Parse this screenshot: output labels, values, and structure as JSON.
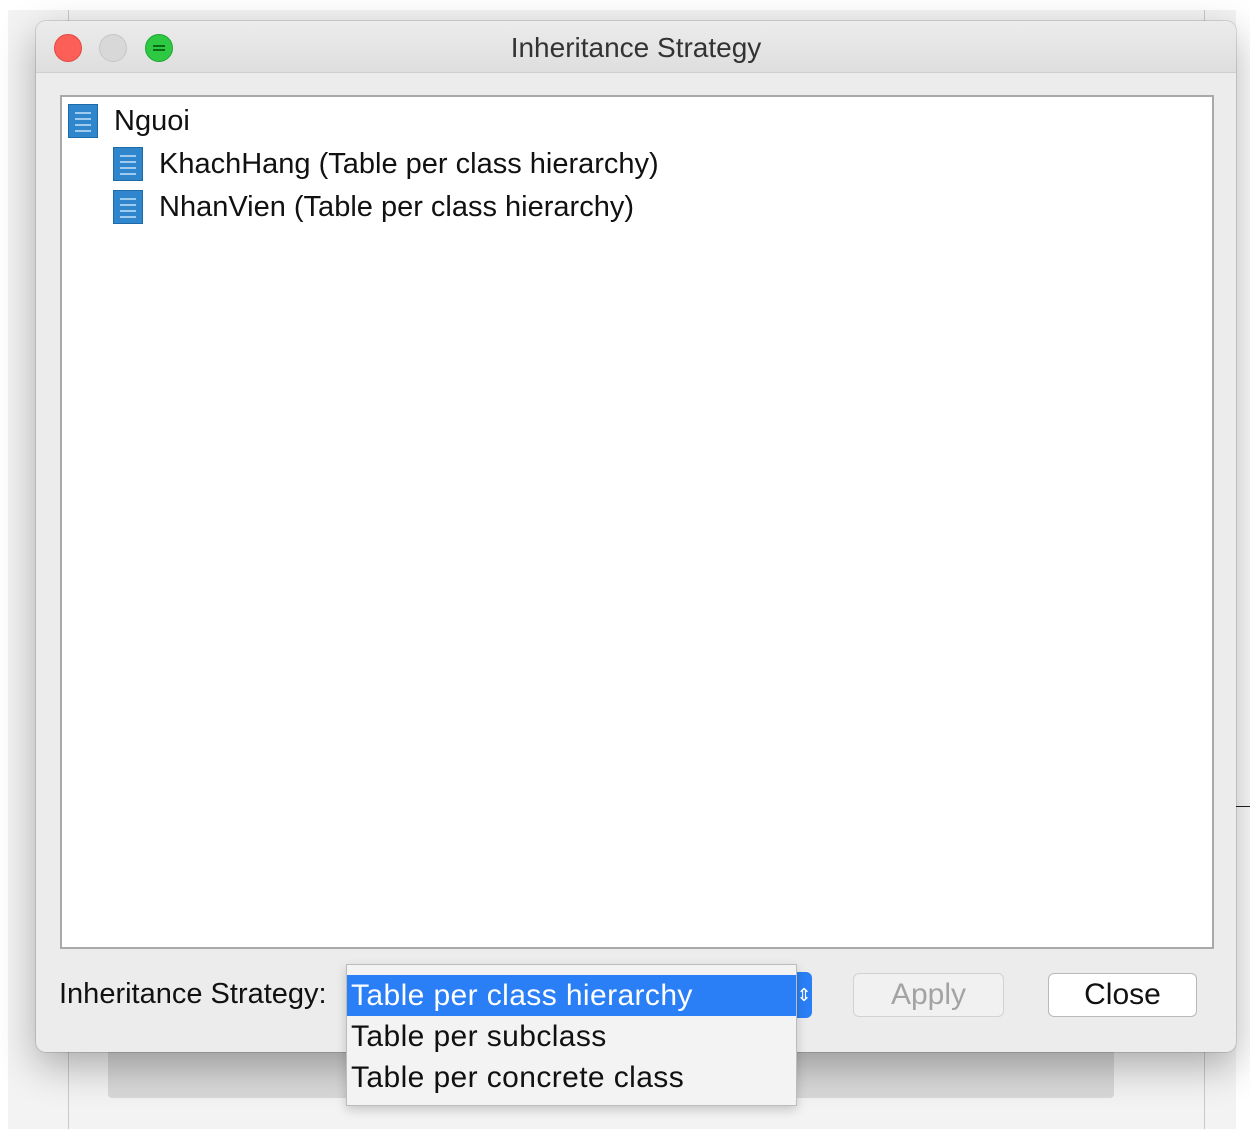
{
  "window": {
    "title": "Inheritance Strategy",
    "traffic_lights": [
      "close-icon",
      "minimize-icon",
      "zoom-icon"
    ]
  },
  "tree": {
    "root": {
      "label": "Nguoi",
      "icon": "entity-icon"
    },
    "children": [
      {
        "label": "KhachHang (Table per class hierarchy)",
        "icon": "entity-icon"
      },
      {
        "label": "NhanVien (Table per class hierarchy)",
        "icon": "entity-icon"
      }
    ]
  },
  "strategy": {
    "label": "Inheritance Strategy:",
    "selected": "Table per class hierarchy",
    "options": [
      "Table per class hierarchy",
      "Table per subclass",
      "Table per concrete class"
    ]
  },
  "buttons": {
    "apply": "Apply",
    "close": "Close"
  },
  "colors": {
    "selection": "#2a7ff6",
    "entity_icon": "#2f86cc",
    "window_bg": "#ececec"
  }
}
